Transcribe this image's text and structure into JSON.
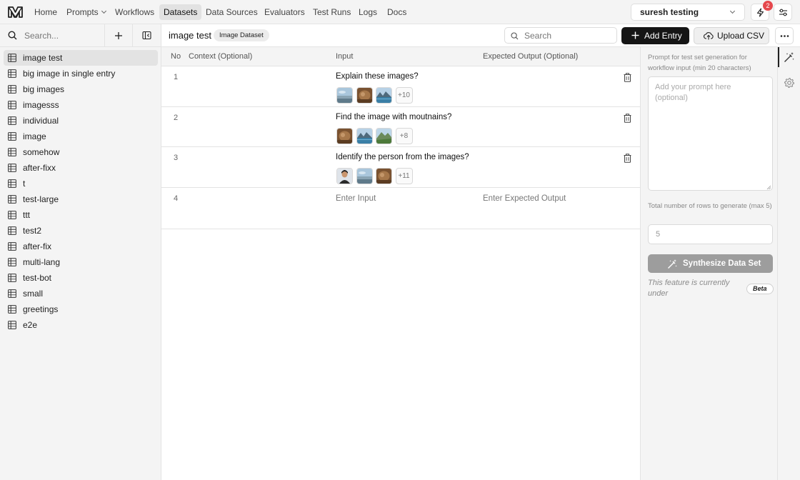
{
  "nav": {
    "items": [
      {
        "label": "Home",
        "active": false,
        "dropdown": false
      },
      {
        "label": "Prompts",
        "active": false,
        "dropdown": true
      },
      {
        "label": "Workflows",
        "active": false,
        "dropdown": false
      },
      {
        "label": "Datasets",
        "active": true,
        "dropdown": false
      },
      {
        "label": "Data Sources",
        "active": false,
        "dropdown": false
      },
      {
        "label": "Evaluators",
        "active": false,
        "dropdown": false
      },
      {
        "label": "Test Runs",
        "active": false,
        "dropdown": false
      },
      {
        "label": "Logs",
        "active": false,
        "dropdown": false
      },
      {
        "label": "Docs",
        "active": false,
        "dropdown": false
      }
    ],
    "workspace": "suresh testing",
    "notification_count": "2"
  },
  "sidebar": {
    "search_placeholder": "Search...",
    "datasets": [
      {
        "label": "image test",
        "active": true
      },
      {
        "label": "big image in single entry"
      },
      {
        "label": "big images"
      },
      {
        "label": "imagesss"
      },
      {
        "label": "individual"
      },
      {
        "label": "image"
      },
      {
        "label": "somehow"
      },
      {
        "label": "after-fixx"
      },
      {
        "label": "t"
      },
      {
        "label": "test-large"
      },
      {
        "label": "ttt"
      },
      {
        "label": "test2"
      },
      {
        "label": "after-fix"
      },
      {
        "label": "multi-lang"
      },
      {
        "label": "test-bot"
      },
      {
        "label": "small"
      },
      {
        "label": "greetings"
      },
      {
        "label": "e2e"
      }
    ]
  },
  "header": {
    "title": "image test",
    "tag": "Image Dataset",
    "search_placeholder": "Search",
    "add_label": "Add Entry",
    "upload_label": "Upload CSV"
  },
  "table": {
    "columns": {
      "no": "No",
      "context": "Context (Optional)",
      "input": "Input",
      "expected": "Expected Output (Optional)"
    },
    "rows": [
      {
        "no": "1",
        "input": "Explain these images?",
        "images": [
          "sky",
          "rock",
          "lake"
        ],
        "more": "+10"
      },
      {
        "no": "2",
        "input": "Find the image with moutnains?",
        "images": [
          "rock",
          "lake",
          "mountain"
        ],
        "more": "+8"
      },
      {
        "no": "3",
        "input": "Identify the person from the images?",
        "images": [
          "person",
          "sky",
          "rock"
        ],
        "more": "+11"
      }
    ],
    "new_row": {
      "no": "4",
      "input_placeholder": "Enter Input",
      "expected_placeholder": "Enter Expected Output"
    }
  },
  "panel": {
    "prompt_label": "Prompt for test set generation for workflow input (min 20 characters)",
    "prompt_placeholder": "Add your prompt here (optional)",
    "rows_label": "Total number of rows to generate (max 5)",
    "rows_placeholder": "5",
    "synth_label": "Synthesize Data Set",
    "note": "This feature is currently under",
    "beta": "Beta"
  }
}
